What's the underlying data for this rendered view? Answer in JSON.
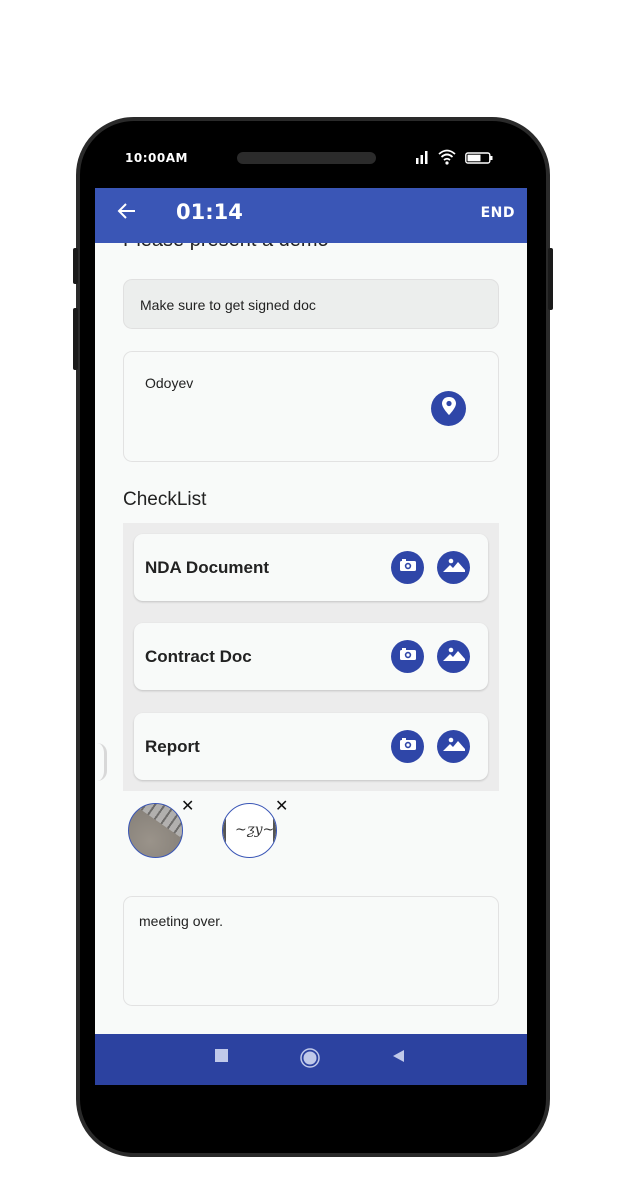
{
  "status_bar": {
    "time": "10:00AM",
    "icons": [
      "signal-icon",
      "wifi-icon",
      "battery-icon"
    ]
  },
  "app_bar": {
    "back_icon": "arrow-left-icon",
    "timer": "01:14",
    "end_label": "END"
  },
  "form": {
    "title_partial": "Please present a demo",
    "note_value": "Make sure to get signed doc",
    "location_value": "Odoyev",
    "location_icon": "map-pin-icon",
    "comment_value": "meeting over."
  },
  "checklist": {
    "title": "CheckList",
    "items": [
      {
        "label": "NDA Document",
        "camera_icon": "camera-icon",
        "gallery_icon": "image-icon"
      },
      {
        "label": "Contract Doc",
        "camera_icon": "camera-icon",
        "gallery_icon": "image-icon"
      },
      {
        "label": "Report",
        "camera_icon": "camera-icon",
        "gallery_icon": "image-icon"
      }
    ]
  },
  "attachments": [
    {
      "type": "photo",
      "remove_label": "✕"
    },
    {
      "type": "signature",
      "remove_label": "✕"
    }
  ],
  "nav_bar": {
    "icons": [
      "recents-square-icon",
      "home-circle-icon",
      "back-triangle-icon"
    ]
  },
  "colors": {
    "primary": "#3a56b6",
    "icon_bg": "#2f46a8",
    "nav_bg": "#2c42a0",
    "surface": "#f8faf9",
    "panel": "#ececec"
  }
}
